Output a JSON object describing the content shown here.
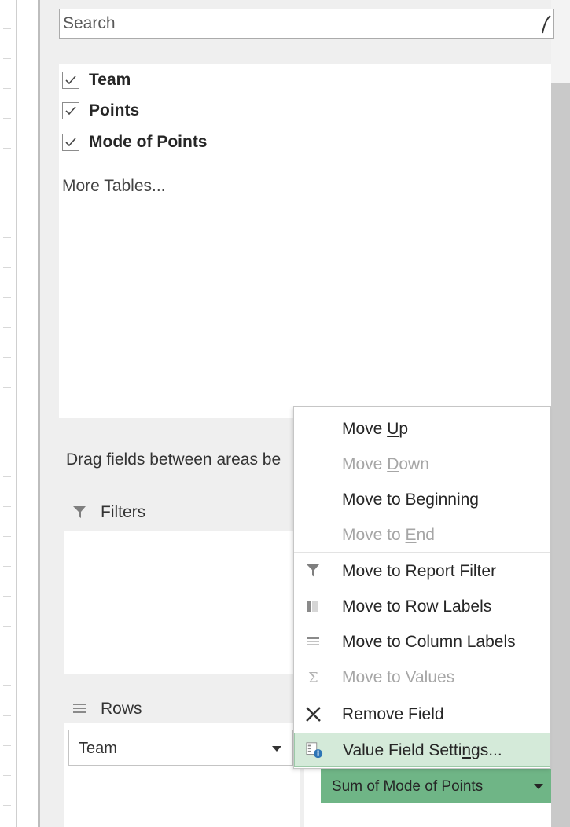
{
  "search": {
    "placeholder": "Search"
  },
  "fields": [
    {
      "label": "Team",
      "checked": true
    },
    {
      "label": "Points",
      "checked": true
    },
    {
      "label": "Mode of Points",
      "checked": true
    }
  ],
  "more_tables": "More Tables...",
  "drag_hint": "Drag fields between areas be",
  "areas": {
    "filters": {
      "label": "Filters"
    },
    "rows": {
      "label": "Rows",
      "field": "Team"
    },
    "values": {
      "field": "Sum of Mode of Points"
    }
  },
  "context_menu": {
    "items": [
      {
        "pre": "Move ",
        "key": "U",
        "post": "p",
        "enabled": true
      },
      {
        "pre": "Move ",
        "key": "D",
        "post": "own",
        "enabled": false
      },
      {
        "pre": "Move to Be",
        "key": "g",
        "post": "inning",
        "enabled": true
      },
      {
        "pre": "Move to ",
        "key": "E",
        "post": "nd",
        "enabled": false
      },
      {
        "pre": "Move to Report Filter",
        "key": "",
        "post": "",
        "enabled": true,
        "icon": "filter-icon"
      },
      {
        "pre": "Move to Row Labels",
        "key": "",
        "post": "",
        "enabled": true,
        "icon": "row-labels-icon"
      },
      {
        "pre": "Move to Column Labels",
        "key": "",
        "post": "",
        "enabled": true,
        "icon": "column-labels-icon"
      },
      {
        "pre": "Move to Values",
        "key": "",
        "post": "",
        "enabled": false,
        "icon": "sigma-icon"
      },
      {
        "pre": "Remove Field",
        "key": "",
        "post": "",
        "enabled": true,
        "icon": "remove-x-icon"
      },
      {
        "pre": "Value Field Setti",
        "key": "n",
        "post": "gs...",
        "enabled": true,
        "icon": "value-field-settings-icon",
        "highlighted": true
      }
    ]
  },
  "colors": {
    "highlight": "#d4ead9",
    "values_field": "#6fb586",
    "disabled_text": "#a6a6a6"
  }
}
